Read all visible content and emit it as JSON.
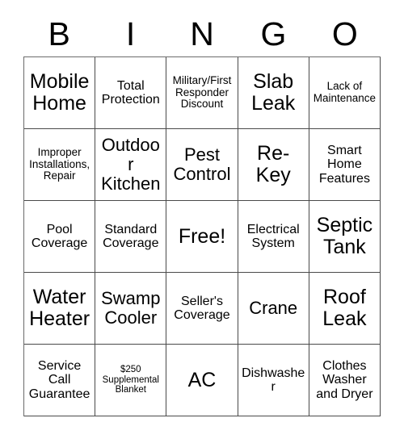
{
  "card": {
    "header_letters": [
      "B",
      "I",
      "N",
      "G",
      "O"
    ],
    "rows": [
      [
        {
          "text": "Mobile Home",
          "size": "fs-xl"
        },
        {
          "text": "Total Protection",
          "size": "fs-md"
        },
        {
          "text": "Military/First Responder Discount",
          "size": "fs-sm"
        },
        {
          "text": "Slab Leak",
          "size": "fs-xl"
        },
        {
          "text": "Lack of Maintenance",
          "size": "fs-sm"
        }
      ],
      [
        {
          "text": "Improper Installations, Repair",
          "size": "fs-sm"
        },
        {
          "text": "Outdoor Kitchen",
          "size": "fs-lg"
        },
        {
          "text": "Pest Control",
          "size": "fs-lg"
        },
        {
          "text": "Re-Key",
          "size": "fs-xl"
        },
        {
          "text": "Smart Home Features",
          "size": "fs-md"
        }
      ],
      [
        {
          "text": "Pool Coverage",
          "size": "fs-md"
        },
        {
          "text": "Standard Coverage",
          "size": "fs-md"
        },
        {
          "text": "Free!",
          "size": "fs-xl"
        },
        {
          "text": "Electrical System",
          "size": "fs-md"
        },
        {
          "text": "Septic Tank",
          "size": "fs-xl"
        }
      ],
      [
        {
          "text": "Water Heater",
          "size": "fs-xl"
        },
        {
          "text": "Swamp Cooler",
          "size": "fs-lg"
        },
        {
          "text": "Seller's Coverage",
          "size": "fs-md"
        },
        {
          "text": "Crane",
          "size": "fs-lg"
        },
        {
          "text": "Roof Leak",
          "size": "fs-xl"
        }
      ],
      [
        {
          "text": "Service Call Guarantee",
          "size": "fs-md"
        },
        {
          "text": "$250 Supplemental Blanket",
          "size": "fs-xs"
        },
        {
          "text": "AC",
          "size": "fs-xl"
        },
        {
          "text": "Dishwasher",
          "size": "fs-md"
        },
        {
          "text": "Clothes Washer and Dryer",
          "size": "fs-md"
        }
      ]
    ],
    "free_space_text": "Free!",
    "colors": {
      "background": "#ffffff",
      "text": "#000000",
      "grid_line": "#4a4a4a"
    }
  }
}
